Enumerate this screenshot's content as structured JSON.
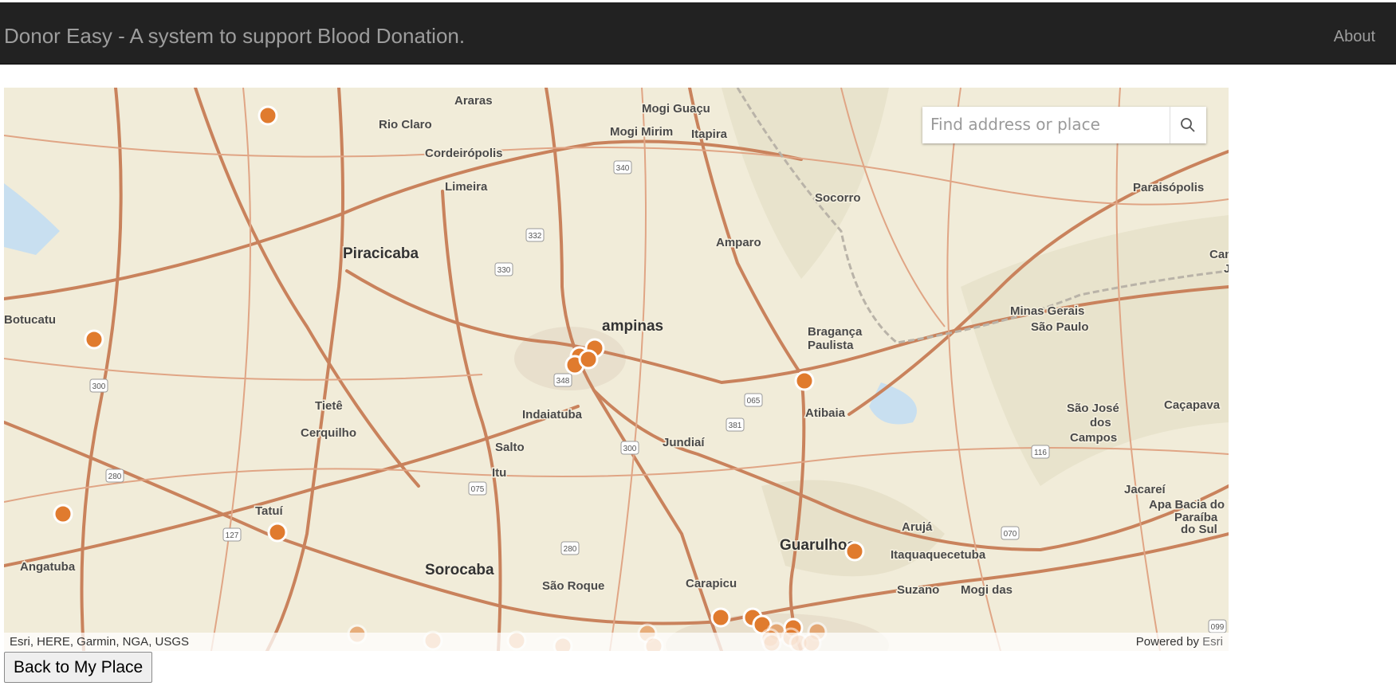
{
  "app": {
    "title": "Donor Easy - A system to support Blood Donation."
  },
  "nav": {
    "about_label": "About"
  },
  "search": {
    "placeholder": "Find address or place"
  },
  "map": {
    "attribution_left": "Esri, HERE, Garmin, NGA, USGS",
    "attribution_powered": "Powered by",
    "attribution_brand": "Esri",
    "places": {
      "araras": "Araras",
      "rio_claro": "Rio Claro",
      "mogi_guacu": "Mogi Guaçu",
      "mogi_mirim": "Mogi Mirim",
      "itapira": "Itapira",
      "cordeiropolis": "Cordeirópolis",
      "limeira": "Limeira",
      "paraisopolis": "Paraisópolis",
      "socorro": "Socorro",
      "piracicaba": "Piracicaba",
      "amparo": "Amparo",
      "botucatu": "Botucatu",
      "campinas": "ampinas",
      "braganca": "Bragança",
      "paulista": "Paulista",
      "tiete": "Tietê",
      "cerquilho": "Cerquilho",
      "indaiatuba": "Indaiatuba",
      "jundiai": "Jundiaí",
      "atibaia": "Atibaia",
      "sao_jose": "São José",
      "dos": "dos",
      "campos": "Campos",
      "cacapava": "Caçapava",
      "salto": "Salto",
      "itu": "Itu",
      "tatui": "Tatuí",
      "jacarei": "Jacareí",
      "aruja": "Arujá",
      "guarulhos": "Guarulhos",
      "itaquaquecetuba": "Itaquaquecetuba",
      "angatuba": "Angatuba",
      "sorocaba": "Sorocaba",
      "sao_roque": "São Roque",
      "carapicuiba": "Carapicu",
      "suzano": "Suzano",
      "mogi_das": "Mogi das",
      "minas_gerais": "Minas Gerais",
      "sao_paulo_state": "São Paulo",
      "apa_bacia": "Apa Bacia do R",
      "paraiba": "Paraíba",
      "do_sul": "do Sul",
      "cam": "Cam",
      "j": "J"
    },
    "shields": [
      "340",
      "332",
      "330",
      "348",
      "300",
      "065",
      "381",
      "300",
      "280",
      "075",
      "127",
      "280",
      "116",
      "070",
      "099"
    ]
  },
  "actions": {
    "back_label": "Back to My Place"
  },
  "colors": {
    "navbar": "#222222",
    "marker": "#e07b2e",
    "map_bg": "#f1ecd9",
    "road": "#c9825c"
  }
}
